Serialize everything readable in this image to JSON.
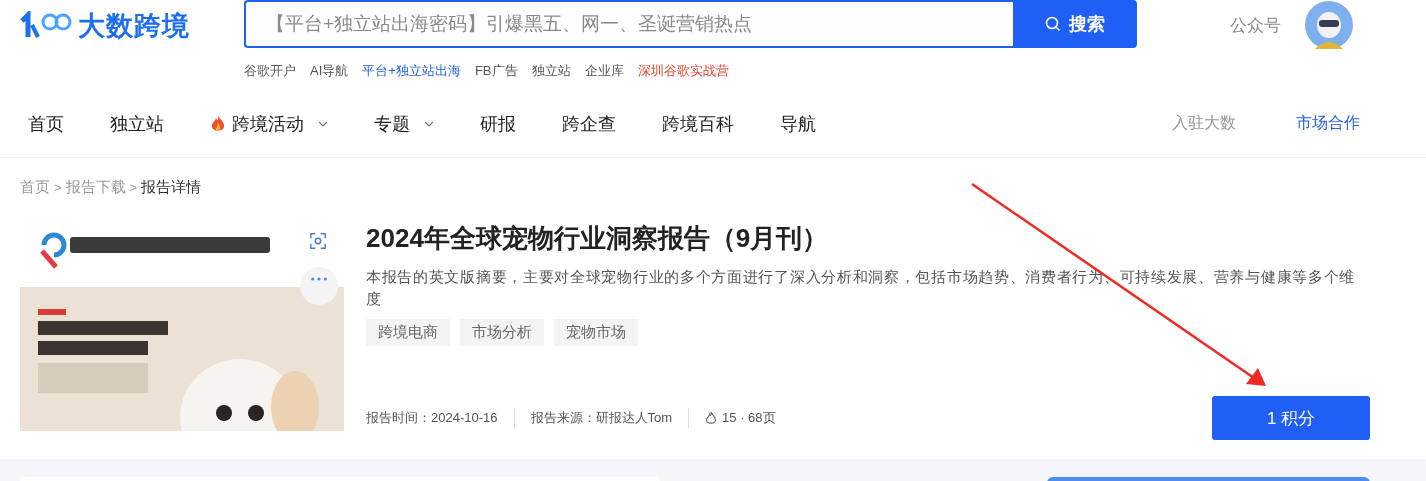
{
  "header": {
    "logo_text": "大数跨境",
    "search": {
      "placeholder": "【平台+独立站出海密码】引爆黑五、网一、圣诞营销热点",
      "button": "搜索"
    },
    "quick_links": [
      {
        "label": "谷歌开户",
        "color": "#555555"
      },
      {
        "label": "AI导航",
        "color": "#555555"
      },
      {
        "label": "平台+独立站出海",
        "color": "#1f5fe0"
      },
      {
        "label": "FB广告",
        "color": "#555555"
      },
      {
        "label": "独立站",
        "color": "#555555"
      },
      {
        "label": "企业库",
        "color": "#555555"
      },
      {
        "label": "深圳谷歌实战营",
        "color": "#e2412c"
      }
    ],
    "account_link": "公众号"
  },
  "nav": {
    "items": [
      {
        "label": "首页",
        "hot": false,
        "dropdown": false
      },
      {
        "label": "独立站",
        "hot": false,
        "dropdown": false
      },
      {
        "label": "跨境活动",
        "hot": true,
        "dropdown": true
      },
      {
        "label": "专题",
        "hot": false,
        "dropdown": true
      },
      {
        "label": "研报",
        "hot": false,
        "dropdown": false
      },
      {
        "label": "跨企查",
        "hot": false,
        "dropdown": false
      },
      {
        "label": "跨境百科",
        "hot": false,
        "dropdown": false
      },
      {
        "label": "导航",
        "hot": false,
        "dropdown": false
      }
    ],
    "right_links": [
      {
        "label": "入驻大数",
        "color": "#999999"
      },
      {
        "label": "市场合作",
        "color": "#2a62d6"
      }
    ]
  },
  "breadcrumb": [
    {
      "kind": "link",
      "label": "首页",
      "current": false
    },
    {
      "kind": "separator",
      "label": ">"
    },
    {
      "kind": "link",
      "label": "报告下载",
      "current": false
    },
    {
      "kind": "separator",
      "label": ">"
    },
    {
      "kind": "link",
      "label": "报告详情",
      "current": true
    }
  ],
  "report": {
    "title": "2024年全球宠物行业洞察报告（9月刊）",
    "description": "本报告的英文版摘要，主要对全球宠物行业的多个方面进行了深入分析和洞察，包括市场趋势、消费者行为、可持续发展、营养与健康等多个维度",
    "tags": [
      "跨境电商",
      "市场分析",
      "宠物市场"
    ],
    "meta": [
      {
        "kind": "text",
        "label": "报告时间：",
        "value": "2024-10-16"
      },
      {
        "kind": "text",
        "label": "报告来源：",
        "value": "研报达人Tom"
      },
      {
        "kind": "hot",
        "value": "15 · 68页"
      }
    ],
    "button": "1 积分"
  }
}
